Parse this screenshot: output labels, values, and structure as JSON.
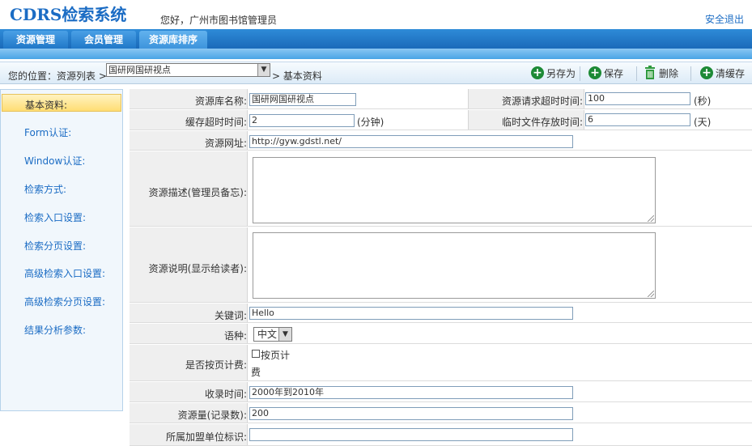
{
  "app": {
    "logo": "CDRS检索系统",
    "greeting": "您好，广州市图书馆管理员",
    "logout": "安全退出"
  },
  "nav": {
    "tabs": [
      "资源管理",
      "会员管理",
      "资源库排序"
    ]
  },
  "breadcrumb": {
    "prefix": "您的位置：资源列表 >",
    "selected_resource": "国研网国研视点",
    "suffix": "> 基本资料"
  },
  "toolbar": {
    "save_as": "另存为",
    "save": "保存",
    "delete": "删除",
    "clear_cache": "清缓存"
  },
  "sidebar": {
    "items": [
      "基本资料:",
      "Form认证:",
      "Window认证:",
      "检索方式:",
      "检索入口设置:",
      "检索分页设置:",
      "高级检索入口设置:",
      "高级检索分页设置:",
      "结果分析参数:"
    ]
  },
  "form": {
    "name_label": "资源库名称:",
    "name_value": "国研网国研视点",
    "timeout_label": "资源请求超时时间:",
    "timeout_value": "100",
    "timeout_unit": "(秒)",
    "cache_label": "缓存超时时间:",
    "cache_value": "2",
    "cache_unit": "(分钟)",
    "temp_label": "临时文件存放时间:",
    "temp_value": "6",
    "temp_unit": "(天)",
    "url_label": "资源网址:",
    "url_value": "http://gyw.gdstl.net/",
    "desc_label": "资源描述(管理员备忘):",
    "note_label": "资源说明(显示给读者):",
    "keyword_label": "关键词:",
    "keyword_value": "Hello",
    "lang_label": "语种:",
    "lang_value": "中文",
    "billing_label": "是否按页计费:",
    "billing_checkbox": "按页计",
    "billing_checkbox_wrap": "费",
    "period_label": "收录时间:",
    "period_value": "2000年到2010年",
    "count_label": "资源量(记录数):",
    "count_value": "200",
    "unit_label": "所属加盟单位标识:",
    "unit_value": ""
  }
}
